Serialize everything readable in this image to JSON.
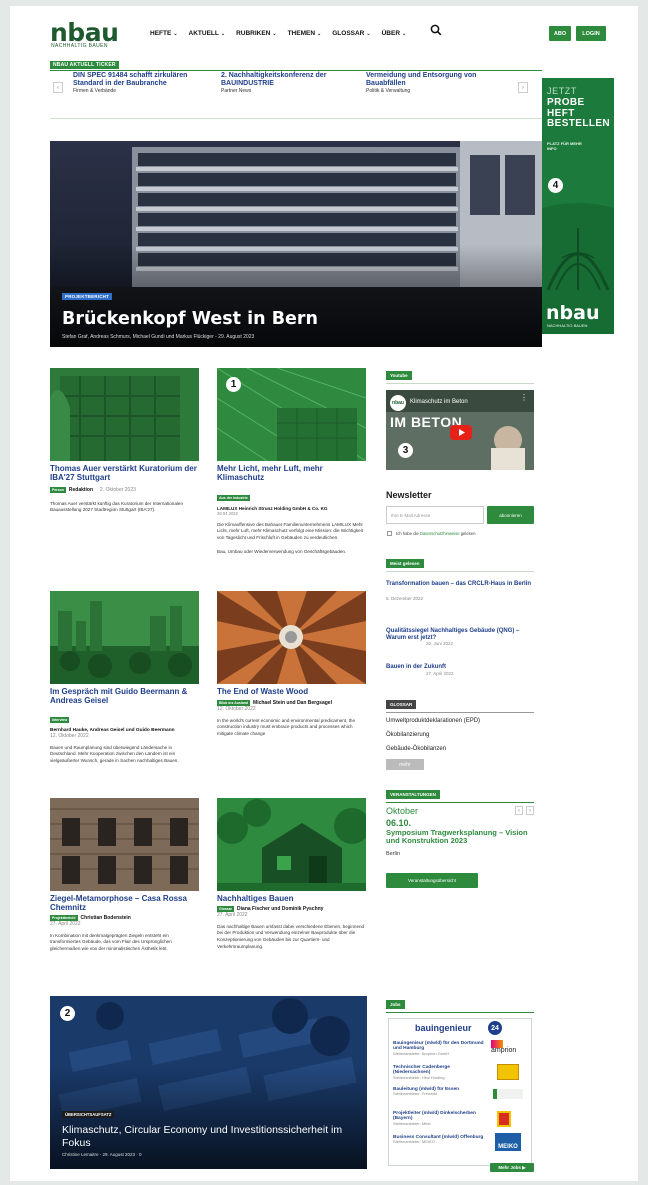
{
  "brand": {
    "logo": "nbau",
    "sub": "NACHHALTIG BAUEN"
  },
  "nav": [
    {
      "label": "HEFTE",
      "chev": "⌄"
    },
    {
      "label": "AKTUELL",
      "chev": "⌄"
    },
    {
      "label": "RUBRIKEN",
      "chev": "⌄"
    },
    {
      "label": "THEMEN",
      "chev": "⌄"
    },
    {
      "label": "GLOSSAR",
      "chev": "⌄"
    },
    {
      "label": "ÜBER",
      "chev": "⌄"
    }
  ],
  "header_buttons": {
    "abo": "ABO",
    "login": "LOGIN"
  },
  "ticker": {
    "label": "NBAU AKTUELL TICKER",
    "prev": "‹",
    "next": "›",
    "items": [
      {
        "title": "DIN SPEC 91484 schafft zirkulären Standard in der Baubranche",
        "cat": "Firmen & Verbände"
      },
      {
        "title": "2. Nachhaltigkeitskonferenz der BAUINDUSTRIE",
        "cat": "Partner News"
      },
      {
        "title": "Vermeidung und Entsorgung von Bauabfällen",
        "cat": "Politik & Verwaltung"
      }
    ]
  },
  "hero": {
    "badge": "PROJEKTBERICHT",
    "title": "Brückenkopf West in Bern",
    "meta": "Stefan Graf, Andreas Schmurs, Michael Gundi und Markus Flückiger  -  29. August 2023"
  },
  "ad": {
    "jetzt": "JETZT",
    "cta": "PROBE\nHEFT\nBESTELLEN",
    "small": "PLATZ FÜR MEHR\nINFO",
    "logo": "nbau",
    "logo_sub": "NACHHALTIG BAUEN"
  },
  "markers": {
    "m1": "1",
    "m2": "2",
    "m3": "3",
    "m4": "4"
  },
  "cards": [
    {
      "title": "Thomas Auer verstärkt Kuratorium der IBA'27 Stuttgart",
      "tag": "Person",
      "author": "Redaktion",
      "date": "2. Oktober 2023",
      "excerpt": "Thomas Auer verstärkt künftig das Kuratorium der Internationalen Bauausstellung 2027 Stadtregion Stuttgart (IBA'27)."
    },
    {
      "title": "Mehr Licht, mehr Luft, mehr Klimaschutz",
      "tag": "Aus der Industrie",
      "author": "LAMILUX Heinrich Strunz Holding GmbH & Co. KG",
      "date": "26.04.2022",
      "excerpt": "Die Klimaoffensive des Bahauer Familienunternehmens LAMILUX Mehr Licht, mehr Luft, mehr Klimaschutz verfolgt eine Mission: die Wichtigkeit von Tageslicht und Frischluft in Gebäuden zu verdeutlichen.",
      "extra": "Bau, Umbau oder Wiederverwendung von Geschäftsgebäuden."
    },
    {
      "title": "Im Gespräch mit Guido Beermann & Andreas Geisel",
      "tag": "Interview",
      "author": "Bernhard Hauke, Andreas Geisel und Guido Beermann",
      "date": "12. Oktober 2022",
      "excerpt": "Bauen und Raumplanung sind überwiegend Ländersache in Deutschland. Mehr Kooperation zwischen den Ländern ist ein vielgeäußerter Wunsch, gerade in Sachen nachhaltiges Bauen."
    },
    {
      "title": "The End of Waste Wood",
      "tag": "Blick ins Ausland",
      "author": "Michael Stein und Dan Bergsagel",
      "date": "12. Oktober 2022",
      "excerpt": "In the world's current economic and environmental predicament, the construction industry must embrace products and processes which mitigate climate change"
    },
    {
      "title": "Ziegel-Metamorphose – Casa Rossa Chemnitz",
      "tag": "Projektbericht",
      "author": "Christian Bodenstein",
      "date": "27. April 2022",
      "excerpt": "In Kombination mit denkmalgeprägten Ziegeln entsteht ein transformiertes Gebäude, das vom Flair des Ursprünglichen gleichermaßen wie von der minimalistischen Ästhetik lebt."
    },
    {
      "title": "Nachhaltiges Bauen",
      "tag": "Glossar",
      "author": "Diana Fischer und Dominik Pyschny",
      "date": "27. April 2022",
      "excerpt": "Das nachhaltige Bauen umfasst dabei verschiedene Ebenen, beginnend bei der Produktion und Verwendung einzelner Bauprodukte über die Konzeptionierung von Gebäuden bis zur Quartiers- und Verkehrsraumplanung."
    }
  ],
  "big_card": {
    "badge": "ÜBERSICHTSAUFSATZ",
    "title": "Klimaschutz, Circular Economy und Investitionssicherheit im Fokus",
    "meta": "Christine Lemaitre  -  29. August 2023  ·  0"
  },
  "sidebar": {
    "youtube": {
      "tab": "Youtube",
      "title": "Klimaschutz im Beton",
      "big": "IM BETON",
      "logo": "nbau"
    },
    "newsletter": {
      "title": "Newsletter",
      "placeholder": "Ihre E-Mail Adresse",
      "button": "abonnieren",
      "consent_pre": "Ich habe die ",
      "consent_link": "Datenschutzhinweise",
      "consent_post": " gelesen."
    },
    "popular": {
      "tab": "Meist gelesen",
      "items": [
        {
          "title": "Transformation bauen – das CRCLR-Haus in Berlin",
          "date": "6. Dezember 2022"
        },
        {
          "title": "Qualitätssiegel Nachhaltiges Gebäude (QNG) – Warum erst jetzt?",
          "date": "20. Juni 2022"
        },
        {
          "title": "Bauen in der Zukunft",
          "date": "27. April 2022"
        }
      ]
    },
    "glossar": {
      "tab": "GLOSSAR",
      "items": [
        "Umweltproduktdeklarationen (EPD)",
        "Ökobilanzierung",
        "Gebäude-Ökobilanzen"
      ],
      "more": "mehr"
    },
    "events": {
      "tab": "VERANSTALTUNGEN",
      "month": "Oktober",
      "day": "06.10.",
      "title": "Symposium Tragwerksplanung – Vision und Konstruktion 2023",
      "location": "Berlin",
      "button": "Veranstaltungsübersicht",
      "prev": "‹",
      "next": "›"
    },
    "jobs": {
      "tab": "Jobs",
      "brand": "bauingenieur",
      "brand_num": "24",
      "items": [
        {
          "title": "Bauingenieur (m/w/d) für den Dortmund und Hamburg",
          "sub": "Stellenanbieter: Amprion GmbH",
          "logo": "amprion"
        },
        {
          "title": "Technischer Cadenberge (Niedersachsen)",
          "sub": "Stellenanbieter: Hinz Holding",
          "logo": ""
        },
        {
          "title": "Bauleitung (m/w/d) für Essen",
          "sub": "Stellenanbieter: Freisinkt",
          "logo": ""
        },
        {
          "title": "Projektleiter (m/w/d) Dinkelscherben (Bayern)",
          "sub": "Stellenanbieter: Mirkt",
          "logo": ""
        },
        {
          "title": "Business Consultant (m/w/d) Offenburg",
          "sub": "Stellenanbieter: MEIKO",
          "logo": "MEIKO"
        }
      ],
      "more": "Mehr Jobs ▶"
    }
  },
  "colors": {
    "green": "#2e8b3e",
    "link_blue": "#1f3f8a",
    "ad_green": "#1b7a3c"
  }
}
